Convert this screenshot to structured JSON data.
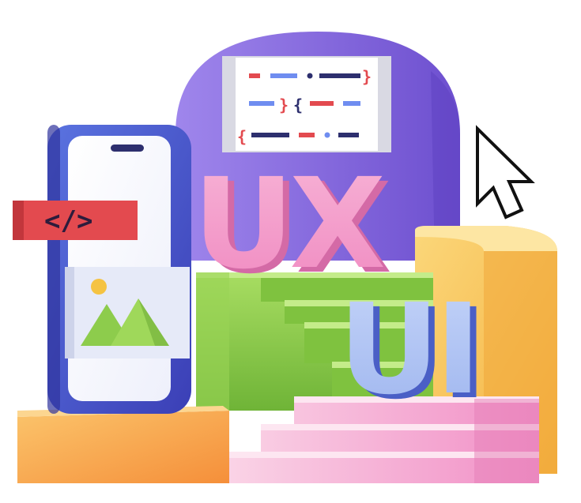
{
  "headline": {
    "ux": "UX",
    "ui": "UI"
  },
  "code_tag": "</>",
  "code_panel": {
    "brace_close": "}",
    "brace_open": "{",
    "brace_open_2": "{"
  },
  "icons": {
    "cursor": "arrow-cursor-icon",
    "image": "image-mountain-icon",
    "code": "code-tag-icon"
  },
  "colors": {
    "arch": "#7b5fd6",
    "arch_light": "#9a80e8",
    "phone_frame": "#4656c8",
    "green": "#8ec94a",
    "yellow": "#f7c35a",
    "orange": "#f6a043",
    "pink": "#f3a2cf",
    "ui_blue": "#b7c8f4",
    "red": "#e34a4f"
  }
}
